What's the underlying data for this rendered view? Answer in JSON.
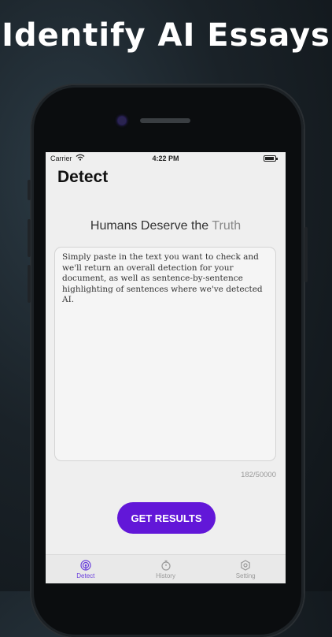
{
  "promo": {
    "title": "Identify AI Essays"
  },
  "status_bar": {
    "carrier": "Carrier",
    "time": "4:22 PM"
  },
  "nav": {
    "title": "Detect"
  },
  "headline": {
    "main": "Humans Deserve the",
    "accent": "Truth"
  },
  "input": {
    "text": "Simply paste in the text you want to check and we'll return an overall detection for your document, as well as sentence-by-sentence highlighting of sentences where we've detected AI.",
    "char_count": "182/50000"
  },
  "actions": {
    "get_results": "GET RESULTS"
  },
  "tabs": [
    {
      "label": "Detect",
      "icon": "radar-icon",
      "active": true
    },
    {
      "label": "History",
      "icon": "stopwatch-icon",
      "active": false
    },
    {
      "label": "Setting",
      "icon": "gear-icon",
      "active": false
    }
  ],
  "colors": {
    "accent": "#6217d8",
    "tab_active": "#6a3fdc"
  }
}
